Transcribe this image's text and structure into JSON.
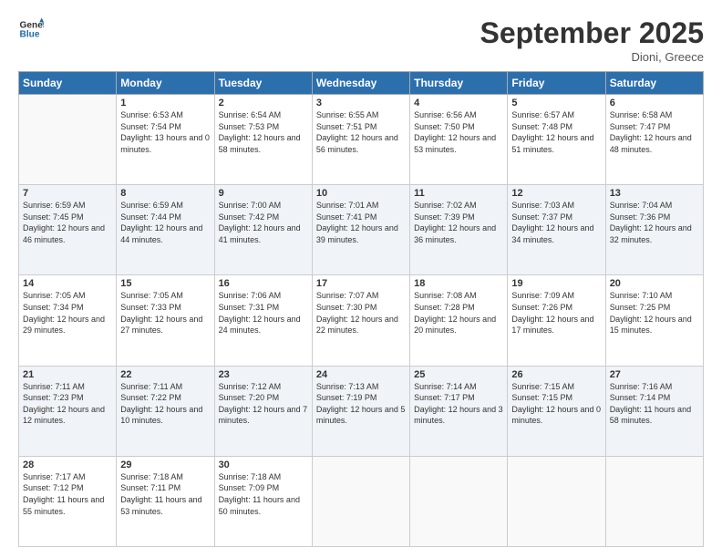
{
  "logo": {
    "line1": "General",
    "line2": "Blue"
  },
  "title": "September 2025",
  "location": "Dioni, Greece",
  "days_header": [
    "Sunday",
    "Monday",
    "Tuesday",
    "Wednesday",
    "Thursday",
    "Friday",
    "Saturday"
  ],
  "weeks": [
    [
      {
        "day": "",
        "sunrise": "",
        "sunset": "",
        "daylight": ""
      },
      {
        "day": "1",
        "sunrise": "Sunrise: 6:53 AM",
        "sunset": "Sunset: 7:54 PM",
        "daylight": "Daylight: 13 hours and 0 minutes."
      },
      {
        "day": "2",
        "sunrise": "Sunrise: 6:54 AM",
        "sunset": "Sunset: 7:53 PM",
        "daylight": "Daylight: 12 hours and 58 minutes."
      },
      {
        "day": "3",
        "sunrise": "Sunrise: 6:55 AM",
        "sunset": "Sunset: 7:51 PM",
        "daylight": "Daylight: 12 hours and 56 minutes."
      },
      {
        "day": "4",
        "sunrise": "Sunrise: 6:56 AM",
        "sunset": "Sunset: 7:50 PM",
        "daylight": "Daylight: 12 hours and 53 minutes."
      },
      {
        "day": "5",
        "sunrise": "Sunrise: 6:57 AM",
        "sunset": "Sunset: 7:48 PM",
        "daylight": "Daylight: 12 hours and 51 minutes."
      },
      {
        "day": "6",
        "sunrise": "Sunrise: 6:58 AM",
        "sunset": "Sunset: 7:47 PM",
        "daylight": "Daylight: 12 hours and 48 minutes."
      }
    ],
    [
      {
        "day": "7",
        "sunrise": "Sunrise: 6:59 AM",
        "sunset": "Sunset: 7:45 PM",
        "daylight": "Daylight: 12 hours and 46 minutes."
      },
      {
        "day": "8",
        "sunrise": "Sunrise: 6:59 AM",
        "sunset": "Sunset: 7:44 PM",
        "daylight": "Daylight: 12 hours and 44 minutes."
      },
      {
        "day": "9",
        "sunrise": "Sunrise: 7:00 AM",
        "sunset": "Sunset: 7:42 PM",
        "daylight": "Daylight: 12 hours and 41 minutes."
      },
      {
        "day": "10",
        "sunrise": "Sunrise: 7:01 AM",
        "sunset": "Sunset: 7:41 PM",
        "daylight": "Daylight: 12 hours and 39 minutes."
      },
      {
        "day": "11",
        "sunrise": "Sunrise: 7:02 AM",
        "sunset": "Sunset: 7:39 PM",
        "daylight": "Daylight: 12 hours and 36 minutes."
      },
      {
        "day": "12",
        "sunrise": "Sunrise: 7:03 AM",
        "sunset": "Sunset: 7:37 PM",
        "daylight": "Daylight: 12 hours and 34 minutes."
      },
      {
        "day": "13",
        "sunrise": "Sunrise: 7:04 AM",
        "sunset": "Sunset: 7:36 PM",
        "daylight": "Daylight: 12 hours and 32 minutes."
      }
    ],
    [
      {
        "day": "14",
        "sunrise": "Sunrise: 7:05 AM",
        "sunset": "Sunset: 7:34 PM",
        "daylight": "Daylight: 12 hours and 29 minutes."
      },
      {
        "day": "15",
        "sunrise": "Sunrise: 7:05 AM",
        "sunset": "Sunset: 7:33 PM",
        "daylight": "Daylight: 12 hours and 27 minutes."
      },
      {
        "day": "16",
        "sunrise": "Sunrise: 7:06 AM",
        "sunset": "Sunset: 7:31 PM",
        "daylight": "Daylight: 12 hours and 24 minutes."
      },
      {
        "day": "17",
        "sunrise": "Sunrise: 7:07 AM",
        "sunset": "Sunset: 7:30 PM",
        "daylight": "Daylight: 12 hours and 22 minutes."
      },
      {
        "day": "18",
        "sunrise": "Sunrise: 7:08 AM",
        "sunset": "Sunset: 7:28 PM",
        "daylight": "Daylight: 12 hours and 20 minutes."
      },
      {
        "day": "19",
        "sunrise": "Sunrise: 7:09 AM",
        "sunset": "Sunset: 7:26 PM",
        "daylight": "Daylight: 12 hours and 17 minutes."
      },
      {
        "day": "20",
        "sunrise": "Sunrise: 7:10 AM",
        "sunset": "Sunset: 7:25 PM",
        "daylight": "Daylight: 12 hours and 15 minutes."
      }
    ],
    [
      {
        "day": "21",
        "sunrise": "Sunrise: 7:11 AM",
        "sunset": "Sunset: 7:23 PM",
        "daylight": "Daylight: 12 hours and 12 minutes."
      },
      {
        "day": "22",
        "sunrise": "Sunrise: 7:11 AM",
        "sunset": "Sunset: 7:22 PM",
        "daylight": "Daylight: 12 hours and 10 minutes."
      },
      {
        "day": "23",
        "sunrise": "Sunrise: 7:12 AM",
        "sunset": "Sunset: 7:20 PM",
        "daylight": "Daylight: 12 hours and 7 minutes."
      },
      {
        "day": "24",
        "sunrise": "Sunrise: 7:13 AM",
        "sunset": "Sunset: 7:19 PM",
        "daylight": "Daylight: 12 hours and 5 minutes."
      },
      {
        "day": "25",
        "sunrise": "Sunrise: 7:14 AM",
        "sunset": "Sunset: 7:17 PM",
        "daylight": "Daylight: 12 hours and 3 minutes."
      },
      {
        "day": "26",
        "sunrise": "Sunrise: 7:15 AM",
        "sunset": "Sunset: 7:15 PM",
        "daylight": "Daylight: 12 hours and 0 minutes."
      },
      {
        "day": "27",
        "sunrise": "Sunrise: 7:16 AM",
        "sunset": "Sunset: 7:14 PM",
        "daylight": "Daylight: 11 hours and 58 minutes."
      }
    ],
    [
      {
        "day": "28",
        "sunrise": "Sunrise: 7:17 AM",
        "sunset": "Sunset: 7:12 PM",
        "daylight": "Daylight: 11 hours and 55 minutes."
      },
      {
        "day": "29",
        "sunrise": "Sunrise: 7:18 AM",
        "sunset": "Sunset: 7:11 PM",
        "daylight": "Daylight: 11 hours and 53 minutes."
      },
      {
        "day": "30",
        "sunrise": "Sunrise: 7:18 AM",
        "sunset": "Sunset: 7:09 PM",
        "daylight": "Daylight: 11 hours and 50 minutes."
      },
      {
        "day": "",
        "sunrise": "",
        "sunset": "",
        "daylight": ""
      },
      {
        "day": "",
        "sunrise": "",
        "sunset": "",
        "daylight": ""
      },
      {
        "day": "",
        "sunrise": "",
        "sunset": "",
        "daylight": ""
      },
      {
        "day": "",
        "sunrise": "",
        "sunset": "",
        "daylight": ""
      }
    ]
  ]
}
